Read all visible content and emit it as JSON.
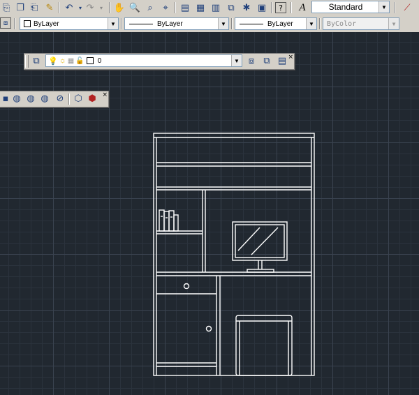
{
  "toolbar_top": {
    "text_style_value": "Standard",
    "icons": [
      "paste-icon",
      "copy-icon",
      "paste-special-icon",
      "match-properties-icon",
      "undo-icon",
      "redo-icon",
      "pan-icon",
      "zoom-realtime-icon",
      "zoom-window-icon",
      "zoom-previous-icon",
      "properties-icon",
      "design-center-icon",
      "tool-palettes-icon",
      "sheet-set-icon",
      "markup-icon",
      "calculator-icon",
      "help-icon",
      "text-style-icon",
      "dimension-style-icon"
    ]
  },
  "properties_bar": {
    "color_value": "ByLayer",
    "linetype_value": "ByLayer",
    "lineweight_value": "ByLayer",
    "plotstyle_value": "ByColor"
  },
  "layer_bar": {
    "current_layer": "0"
  },
  "colors": {
    "canvas_bg": "#212830",
    "grid_major": "#3a4350",
    "grid_minor": "#2b333d",
    "drawing_line": "#ffffff",
    "toolbar_bg": "#d4d0c8"
  }
}
